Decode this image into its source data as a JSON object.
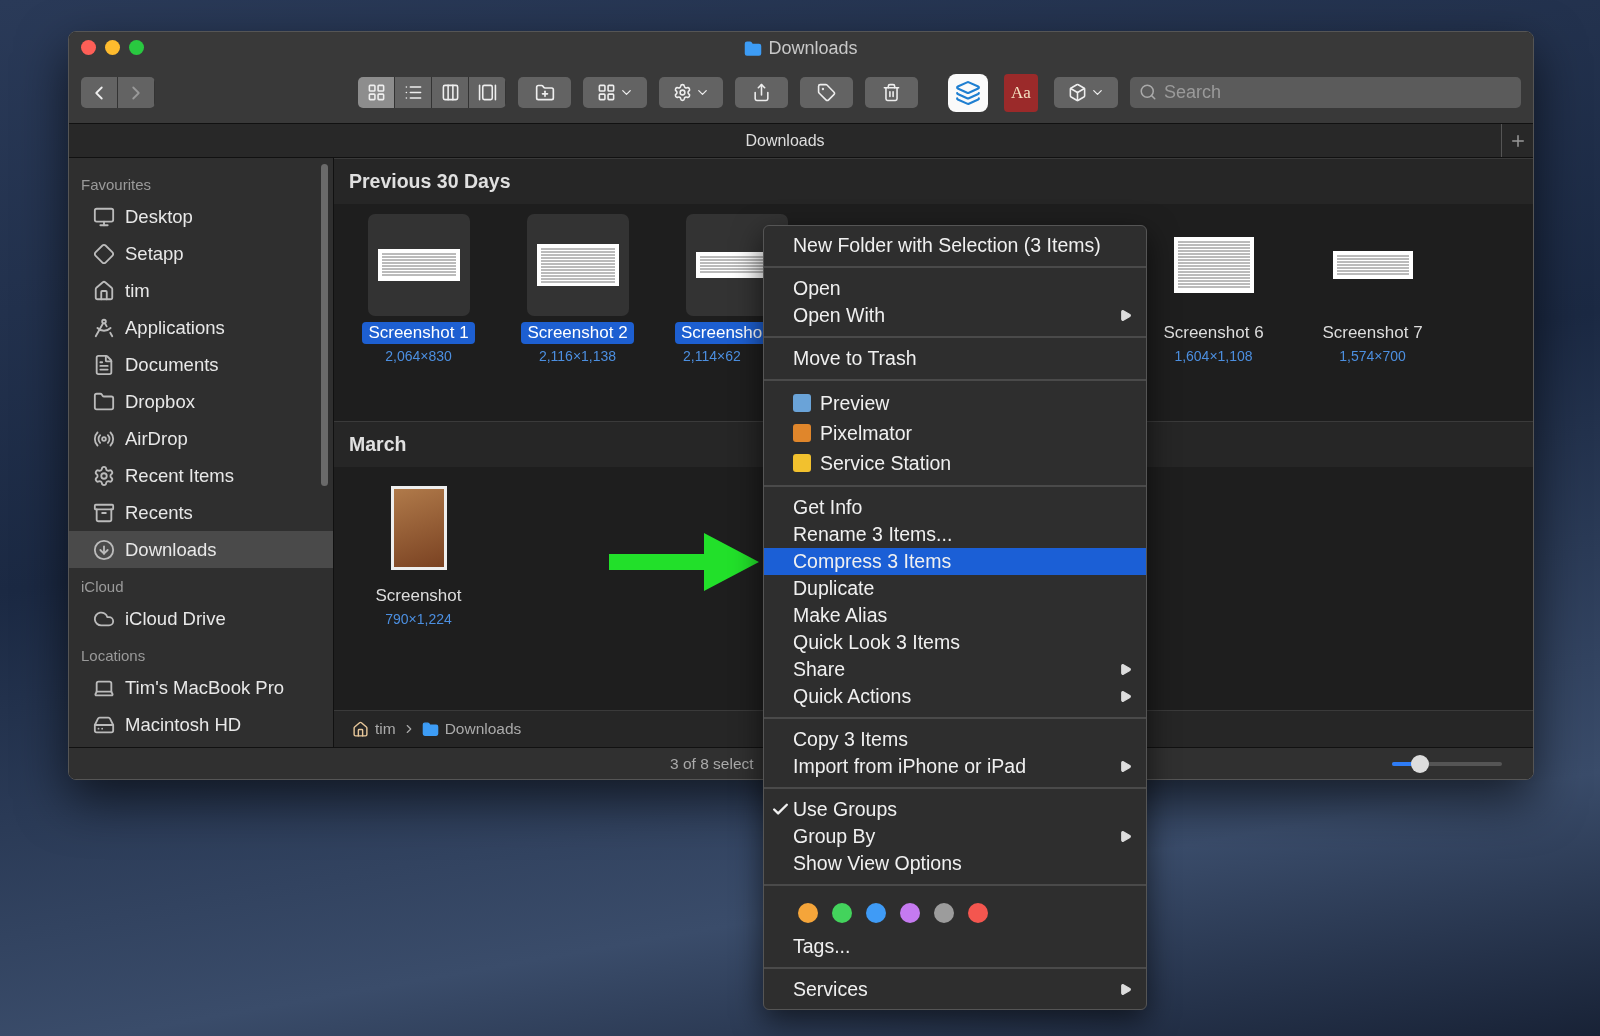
{
  "window": {
    "title": "Downloads"
  },
  "toolbar": {
    "view_modes": [
      {
        "selected": true
      },
      {
        "selected": false
      },
      {
        "selected": false
      },
      {
        "selected": false
      }
    ],
    "dictionary_label": "Aa",
    "search": {
      "placeholder": "Search"
    }
  },
  "tab_bar": {
    "title": "Downloads"
  },
  "sidebar": {
    "sections": [
      {
        "heading": "Favourites",
        "items": [
          {
            "label": "Desktop",
            "selected": false
          },
          {
            "label": "Setapp",
            "selected": false
          },
          {
            "label": "tim",
            "selected": false
          },
          {
            "label": "Applications",
            "selected": false
          },
          {
            "label": "Documents",
            "selected": false
          },
          {
            "label": "Dropbox",
            "selected": false
          },
          {
            "label": "AirDrop",
            "selected": false
          },
          {
            "label": "Recent Items",
            "selected": false
          },
          {
            "label": "Recents",
            "selected": false
          },
          {
            "label": "Downloads",
            "selected": true
          }
        ]
      },
      {
        "heading": "iCloud",
        "items": [
          {
            "label": "iCloud Drive",
            "selected": false
          }
        ]
      },
      {
        "heading": "Locations",
        "items": [
          {
            "label": "Tim's MacBook Pro",
            "selected": false
          },
          {
            "label": "Macintosh HD",
            "selected": false
          }
        ]
      }
    ]
  },
  "groups": [
    {
      "title": "Previous 30 Days",
      "items": [
        {
          "kind": "document",
          "name": "Screenshot 1",
          "dimensions": "2,064×830",
          "selected": true
        },
        {
          "kind": "document",
          "name": "Screenshot 2",
          "dimensions": "2,116×1,138",
          "selected": true
        },
        {
          "kind": "document",
          "name": "Screensho",
          "dimensions": "2,114×62",
          "selected": true
        },
        {
          "kind": "document",
          "name": "Screenshot 6",
          "dimensions": "1,604×1,108",
          "selected": false
        },
        {
          "kind": "document",
          "name": "Screenshot 7",
          "dimensions": "1,574×700",
          "selected": false
        }
      ]
    },
    {
      "title": "March",
      "items": [
        {
          "kind": "photo",
          "name": "Screenshot",
          "dimensions": "790×1,224",
          "selected": false
        }
      ]
    }
  ],
  "path_bar": [
    "tim",
    "Downloads"
  ],
  "status_bar": {
    "text": "3 of 8 select",
    "zoom": {
      "level": 0.25
    }
  },
  "context_menu": {
    "sections": [
      {
        "items": [
          {
            "label": "New Folder with Selection (3 Items)",
            "selected": false,
            "submenu": false
          }
        ]
      },
      {
        "items": [
          {
            "label": "Open",
            "selected": false,
            "submenu": false
          },
          {
            "label": "Open With",
            "selected": false,
            "submenu": true
          }
        ]
      },
      {
        "items": [
          {
            "label": "Move to Trash",
            "selected": false,
            "submenu": false
          }
        ]
      },
      {
        "kind": "apps",
        "items": [
          {
            "label": "Preview",
            "selected": false,
            "submenu": false
          },
          {
            "label": "Pixelmator",
            "selected": false,
            "submenu": false
          },
          {
            "label": "Service Station",
            "selected": false,
            "submenu": false
          }
        ]
      },
      {
        "items": [
          {
            "label": "Get Info",
            "selected": false,
            "submenu": false
          },
          {
            "label": "Rename 3 Items...",
            "selected": false,
            "submenu": false
          },
          {
            "label": "Compress 3 Items",
            "selected": true,
            "submenu": false
          },
          {
            "label": "Duplicate",
            "selected": false,
            "submenu": false
          },
          {
            "label": "Make Alias",
            "selected": false,
            "submenu": false
          },
          {
            "label": "Quick Look 3 Items",
            "selected": false,
            "submenu": false
          },
          {
            "label": "Share",
            "selected": false,
            "submenu": true
          },
          {
            "label": "Quick Actions",
            "selected": false,
            "submenu": true
          }
        ]
      },
      {
        "items": [
          {
            "label": "Copy 3 Items",
            "selected": false,
            "submenu": false
          },
          {
            "label": "Import from iPhone or iPad",
            "selected": false,
            "submenu": true
          }
        ]
      },
      {
        "items": [
          {
            "label": "Use Groups",
            "selected": false,
            "submenu": false,
            "checked": true
          },
          {
            "label": "Group By",
            "selected": false,
            "submenu": true,
            "checked": false
          },
          {
            "label": "Show View Options",
            "selected": false,
            "submenu": false,
            "checked": false
          }
        ]
      },
      {
        "kind": "tags",
        "tags": [
          {
            "color": "#f5a53a"
          },
          {
            "color": "#43d35c"
          },
          {
            "color": "#3f9bf6"
          },
          {
            "color": "#c57af0"
          },
          {
            "color": "#9c9c9c"
          },
          {
            "color": "#f4564f"
          }
        ],
        "items": [
          {
            "label": "Tags...",
            "selected": false,
            "submenu": false
          }
        ]
      },
      {
        "items": [
          {
            "label": "Services",
            "selected": false,
            "submenu": true
          }
        ]
      }
    ]
  }
}
